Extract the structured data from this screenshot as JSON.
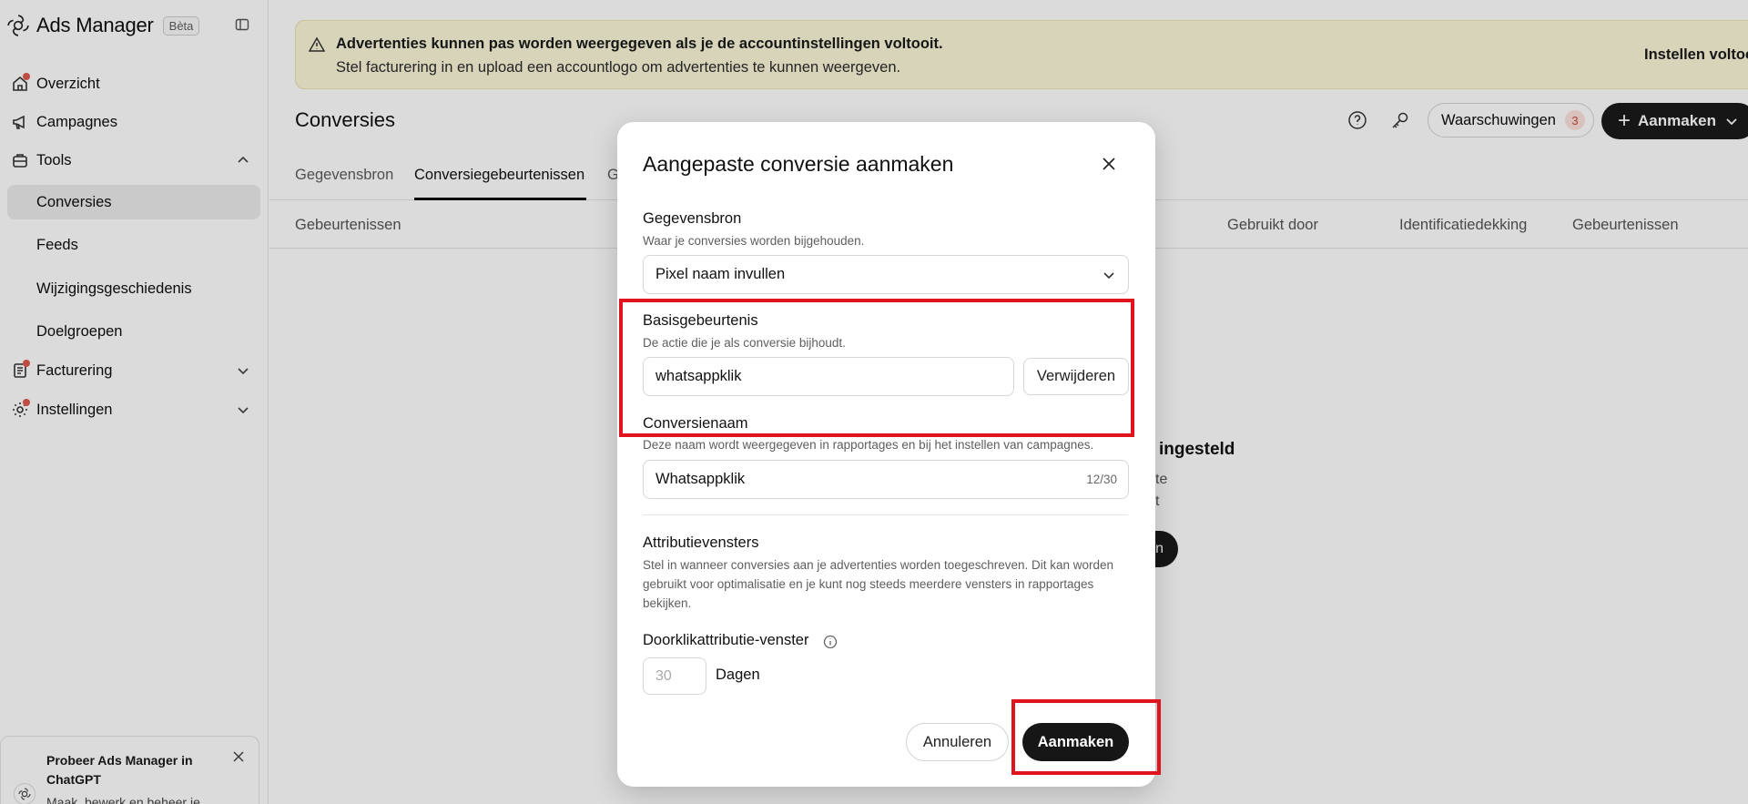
{
  "app": {
    "name": "Ads Manager",
    "badge": "Bèta"
  },
  "sidebar": {
    "items": [
      {
        "label": "Overzicht",
        "icon": "home-icon",
        "dot": true
      },
      {
        "label": "Campagnes",
        "icon": "megaphone-icon",
        "dot": false
      },
      {
        "label": "Tools",
        "icon": "toolbox-icon",
        "expanded": true
      },
      {
        "label": "Conversies",
        "active": true
      },
      {
        "label": "Feeds"
      },
      {
        "label": "Wijzigingsgeschiedenis"
      },
      {
        "label": "Doelgroepen"
      },
      {
        "label": "Facturering",
        "icon": "invoice-icon",
        "dot": true
      },
      {
        "label": "Instellingen",
        "icon": "gear-icon",
        "dot": true
      }
    ],
    "promo": {
      "title": "Probeer Ads Manager in ChatGPT",
      "subtitle": "Maak, bewerk en beheer je"
    }
  },
  "banner": {
    "title": "Advertenties kunnen pas worden weergegeven als je de accountinstellingen voltooit.",
    "subtitle": "Stel facturering in en upload een accountlogo om advertenties te kunnen weergeven.",
    "action": "Instellen voltooien"
  },
  "header": {
    "title": "Conversies",
    "warnings_label": "Waarschuwingen",
    "warnings_count": "3",
    "create_label": "Aanmaken"
  },
  "tabs": [
    "Gegevensbron",
    "Conversiegebeurtenissen",
    "G"
  ],
  "columns": [
    "Gebeurtenissen",
    "Gebruikt door",
    "Identificatiedekking",
    "Gebeurtenissen"
  ],
  "empty": {
    "title": "ingesteld",
    "line1": "te",
    "line2": "t",
    "button": "n"
  },
  "modal": {
    "title": "Aangepaste conversie aanmaken",
    "datasource": {
      "label": "Gegevensbron",
      "help": "Waar je conversies worden bijgehouden.",
      "value": "Pixel naam invullen"
    },
    "base_event": {
      "label": "Basisgebeurtenis",
      "help": "De actie die je als conversie bijhoudt.",
      "value": "whatsappklik",
      "remove": "Verwijderen"
    },
    "conversion_name": {
      "label": "Conversienaam",
      "help": "Deze naam wordt weergegeven in rapportages en bij het instellen van campagnes.",
      "value": "Whatsappklik",
      "counter": "12/30"
    },
    "attribution": {
      "label": "Attributievensters",
      "help": "Stel in wanneer conversies aan je advertenties worden toegeschreven. Dit kan worden gebruikt voor optimalisatie en je kunt nog steeds meerdere vensters in rapportages bekijken."
    },
    "click_window": {
      "label": "Doorklikattributie-venster",
      "placeholder": "30",
      "unit": "Dagen"
    },
    "cancel": "Annuleren",
    "create": "Aanmaken"
  }
}
